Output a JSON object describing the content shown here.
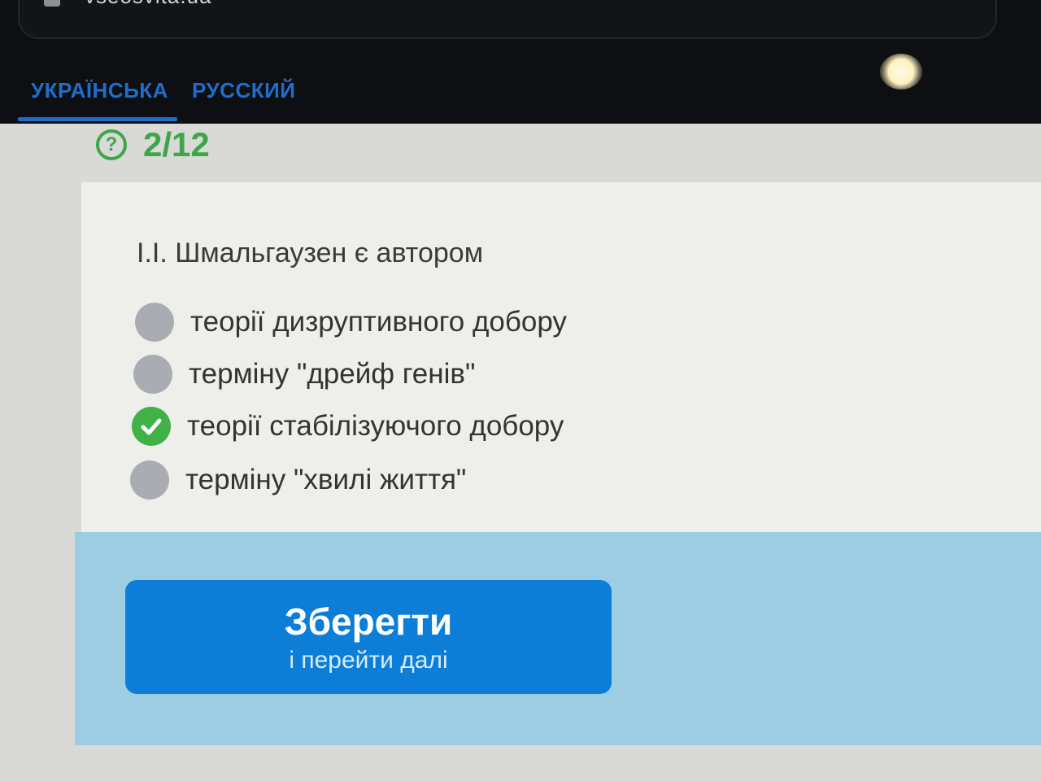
{
  "browser": {
    "url": "vseosvita.ua"
  },
  "language_tabs": [
    {
      "label": "УКРАЇНСЬКА",
      "active": true
    },
    {
      "label": "РУССКИЙ",
      "active": false
    }
  ],
  "progress": {
    "icon": "question-circle-icon",
    "counter": "2/12"
  },
  "question": {
    "text": "І.І. Шмальгаузен є автором",
    "options": [
      {
        "label": "теорії дизруптивного добору",
        "selected": false
      },
      {
        "label": "терміну \"дрейф генів\"",
        "selected": false
      },
      {
        "label": "теорії стабілізуючого добору",
        "selected": true
      },
      {
        "label": "терміну \"хвилі життя\"",
        "selected": false
      }
    ]
  },
  "save_button": {
    "title": "Зберегти",
    "subtitle": "і перейти далі"
  },
  "colors": {
    "accent_blue": "#1f6ecb",
    "button_blue": "#0c7ed8",
    "success_green": "#3ea64a",
    "footer_bg": "#9ccde3"
  }
}
